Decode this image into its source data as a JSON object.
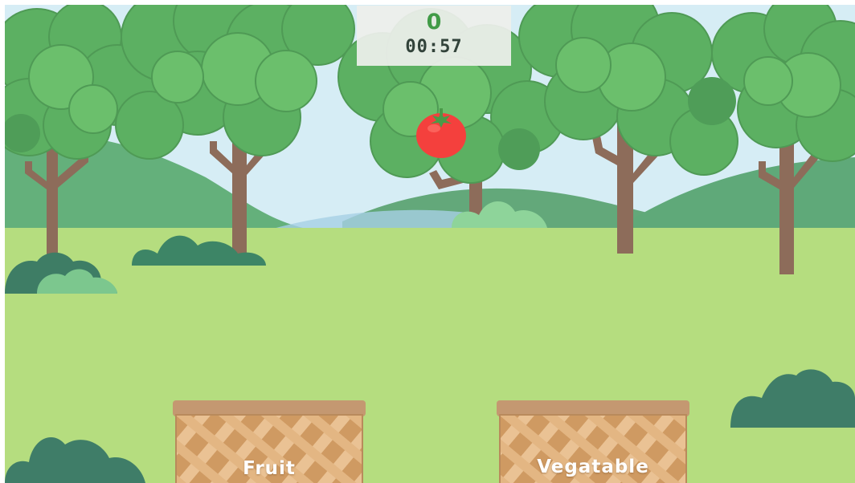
{
  "hud": {
    "score": "0",
    "timer": "00:57"
  },
  "falling_item": {
    "name": "tomato",
    "icon": "tomato-icon",
    "color": "#f4403d"
  },
  "baskets": [
    {
      "label": "Fruit"
    },
    {
      "label": "Vegatable"
    }
  ],
  "colors": {
    "sky": "#d8eef6",
    "grass": "#b5dd7f",
    "foliage": "#5fb565",
    "trunk": "#8d6c5a",
    "bush_dark": "#3f7d68",
    "basket": "#d9a874"
  }
}
